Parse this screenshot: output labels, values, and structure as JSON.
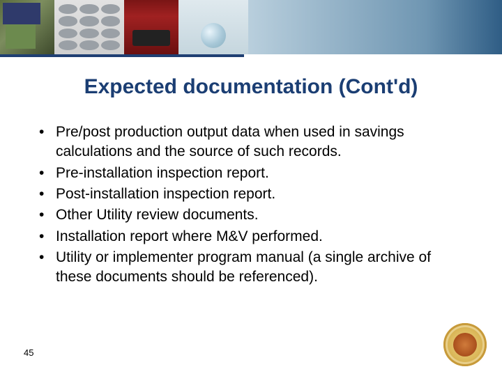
{
  "title": "Expected documentation (Cont'd)",
  "bullets": [
    "Pre/post production output data when used in savings calculations and the source of such records.",
    "Pre-installation inspection report.",
    "Post-installation inspection report.",
    "Other Utility review documents.",
    "Installation report where M&V performed.",
    "Utility or implementer program manual (a single archive of these documents should be referenced)."
  ],
  "page_number": "45"
}
